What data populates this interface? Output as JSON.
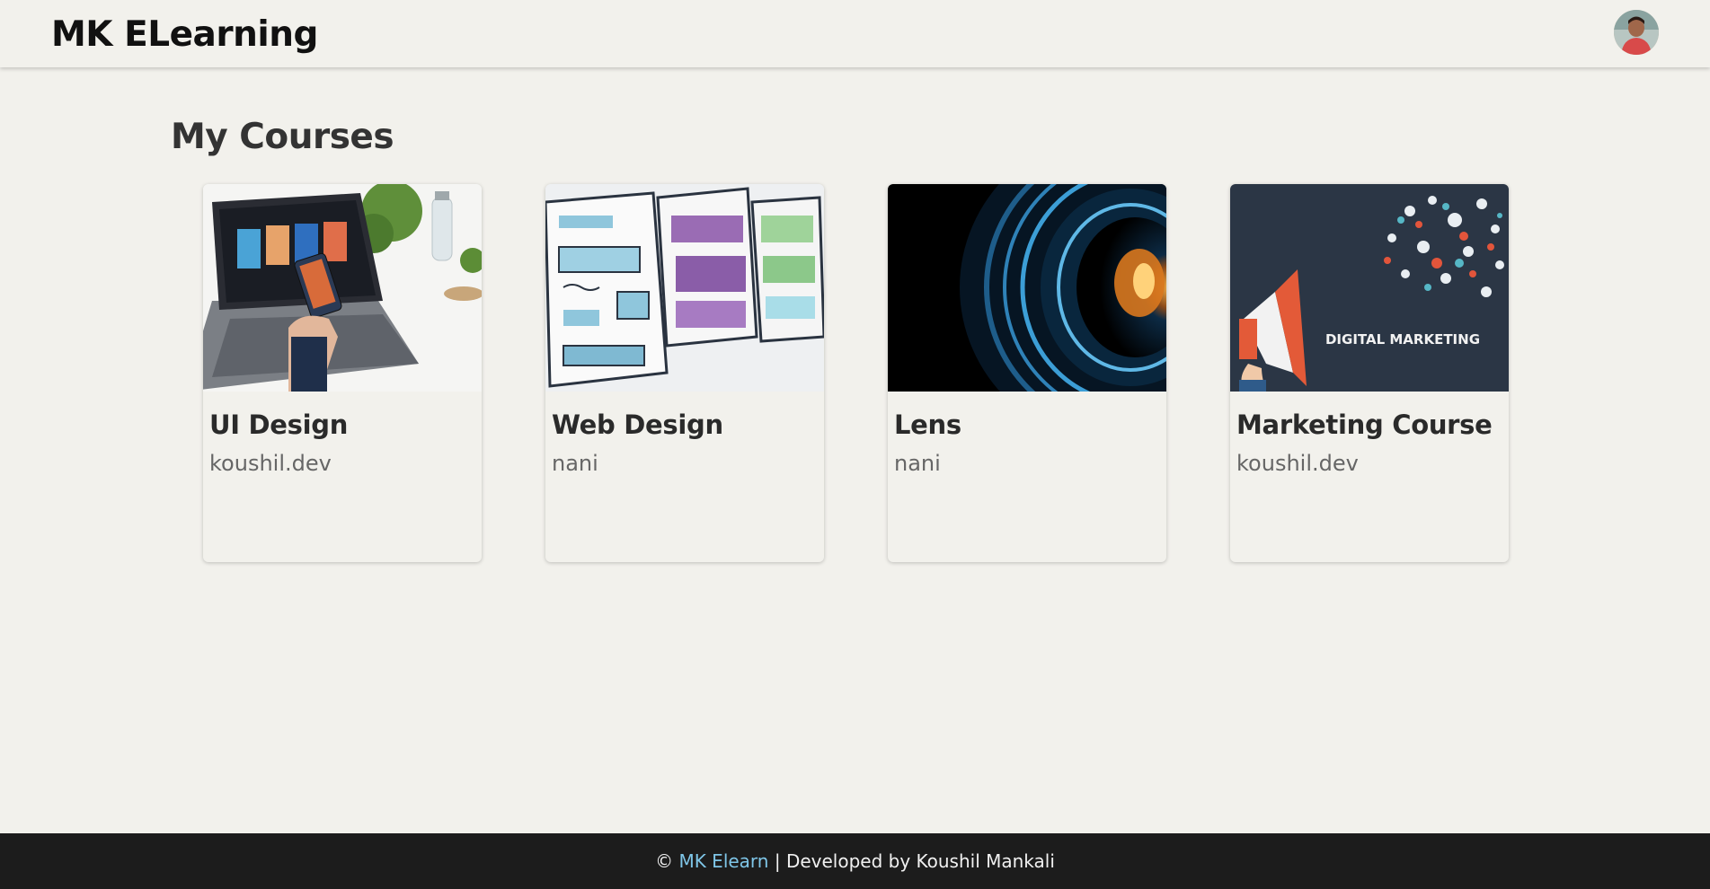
{
  "header": {
    "brand": "MK ELearning",
    "avatar_alt": "user avatar"
  },
  "main": {
    "title": "My Courses",
    "courses": [
      {
        "name": "UI Design",
        "author": "koushil.dev"
      },
      {
        "name": "Web Design",
        "author": "nani"
      },
      {
        "name": "Lens",
        "author": "nani"
      },
      {
        "name": "Marketing Course",
        "author": "koushil.dev",
        "thumb_text": "DIGITAL MARKETING"
      }
    ]
  },
  "footer": {
    "copyright": "©",
    "link": "MK Elearn",
    "text": " | Developed by Koushil Mankali"
  },
  "colors": {
    "background": "#f2f1ec",
    "footer_bg": "#1c1c1c",
    "footer_link": "#7fc6e8"
  }
}
